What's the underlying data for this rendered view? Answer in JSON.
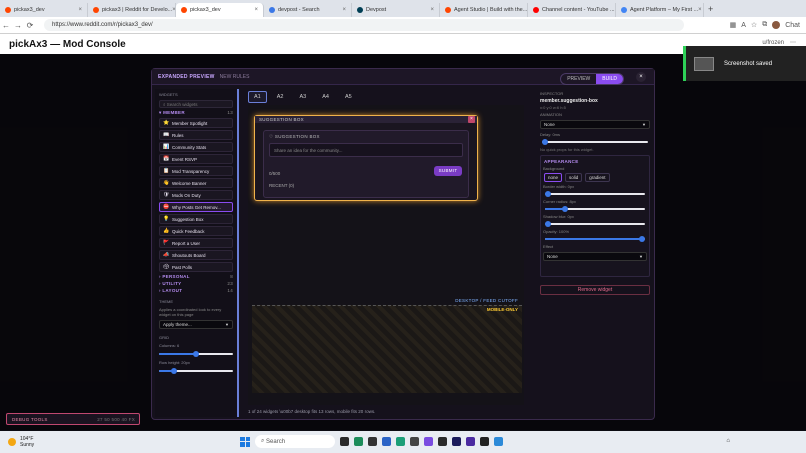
{
  "browser": {
    "tabs": [
      {
        "label": "pickax3_dev",
        "color": "#ff4500"
      },
      {
        "label": "pickax3 | Reddit for Develo...",
        "color": "#ff4500"
      },
      {
        "label": "pickax3_dev",
        "color": "#ff4500",
        "active": true
      },
      {
        "label": "devpost - Search",
        "color": "#3b78e7"
      },
      {
        "label": "Devpost",
        "color": "#003e54"
      },
      {
        "label": "Agent Studio | Build with the...",
        "color": "#ff4500"
      },
      {
        "label": "Channel content - YouTube ...",
        "color": "#ff0000"
      },
      {
        "label": "Agent Platform – My First ...",
        "color": "#4285f4"
      }
    ],
    "url": "https://www.reddit.com/r/pickax3_dev/",
    "profile_label": "Chat"
  },
  "app": {
    "title": "pickAx3 — Mod Console",
    "user": "u/frozen"
  },
  "modal": {
    "title": "EXPANDED PREVIEW",
    "subtitle": "NEW RULES",
    "mode_preview": "PREVIEW",
    "mode_build": "BUILD",
    "close": "×"
  },
  "sidebar": {
    "widgets_label": "WIDGETS",
    "search_placeholder": "Search widgets",
    "category_member": {
      "label": "MEMBER",
      "count": "13"
    },
    "items": [
      {
        "label": "Member Spotlight",
        "icon": "⭐"
      },
      {
        "label": "Rules",
        "icon": "📖"
      },
      {
        "label": "Community Stats",
        "icon": "📊"
      },
      {
        "label": "Event RSVP",
        "icon": "📅"
      },
      {
        "label": "Mod Transparency",
        "icon": "📋"
      },
      {
        "label": "Welcome Banner",
        "icon": "👋"
      },
      {
        "label": "Mods On Duty",
        "icon": "🛡"
      },
      {
        "label": "Why Posts Get Remov...",
        "icon": "⛔"
      },
      {
        "label": "Suggestion Box",
        "icon": "💡"
      },
      {
        "label": "Quick Feedback",
        "icon": "👍"
      },
      {
        "label": "Report a User",
        "icon": "🚩"
      },
      {
        "label": "Shoutouts Board",
        "icon": "📣"
      },
      {
        "label": "Past Polls",
        "icon": "🗳"
      }
    ],
    "categories_collapsed": [
      {
        "label": "PERSONAL",
        "count": "8"
      },
      {
        "label": "UTILITY",
        "count": "23"
      },
      {
        "label": "LAYOUT",
        "count": "14"
      }
    ],
    "theme_label": "THEME",
    "theme_note": "Applies a coordinated look to every widget on this page",
    "theme_select": "Apply theme...",
    "grid_label": "GRID",
    "columns_label": "Columns: 6",
    "columns_level": 0.5,
    "row_height_label": "Row height: 20px",
    "row_height_level": 0.2
  },
  "main": {
    "page_tabs": [
      "A1",
      "A2",
      "A3",
      "A4",
      "A5"
    ],
    "widget_header": "SUGGESTION BOX",
    "inner_title": "SUGGESTION BOX",
    "input_placeholder": "Share an idea for the community...",
    "count": "0/500",
    "submit": "SUBMIT",
    "recent": "RECENT (0)",
    "cutoff_label": "DESKTOP / FEED CUTOFF",
    "mobile_label": "MOBILE-ONLY",
    "footer": "1 of 24 widgets \\u00b7 desktop fits 13 rows, mobile fits 20 rows."
  },
  "inspector": {
    "label": "INSPECTOR",
    "name": "member.suggestion-box",
    "coords": "x:0 y:0 w:6 h:5",
    "animation_label": "ANIMATION",
    "animation_value": "None",
    "delay_label": "Delay: 0ms",
    "delay_level": 0.02,
    "no_props": "No quick props for this widget.",
    "appearance_label": "APPEARANCE",
    "background_label": "Background",
    "bg_options": [
      "none",
      "solid",
      "gradient"
    ],
    "border_label": "Border width: 0px",
    "border_level": 0.02,
    "radius_label": "Corner radius: 8px",
    "radius_level": 0.2,
    "shadow_label": "Shadow blur: 0px",
    "shadow_level": 0.02,
    "opacity_label": "Opacity: 100%",
    "opacity_level": 1.0,
    "effect_label": "Effect",
    "effect_value": "None",
    "remove": "Remove widget"
  },
  "debug": {
    "label": "DEBUG TOOLS",
    "right": "27 50 500 40 FX"
  },
  "toast": {
    "text": "Screenshot saved"
  },
  "taskbar": {
    "temp": "104°F",
    "cond": "Sunny",
    "search": "Search"
  }
}
